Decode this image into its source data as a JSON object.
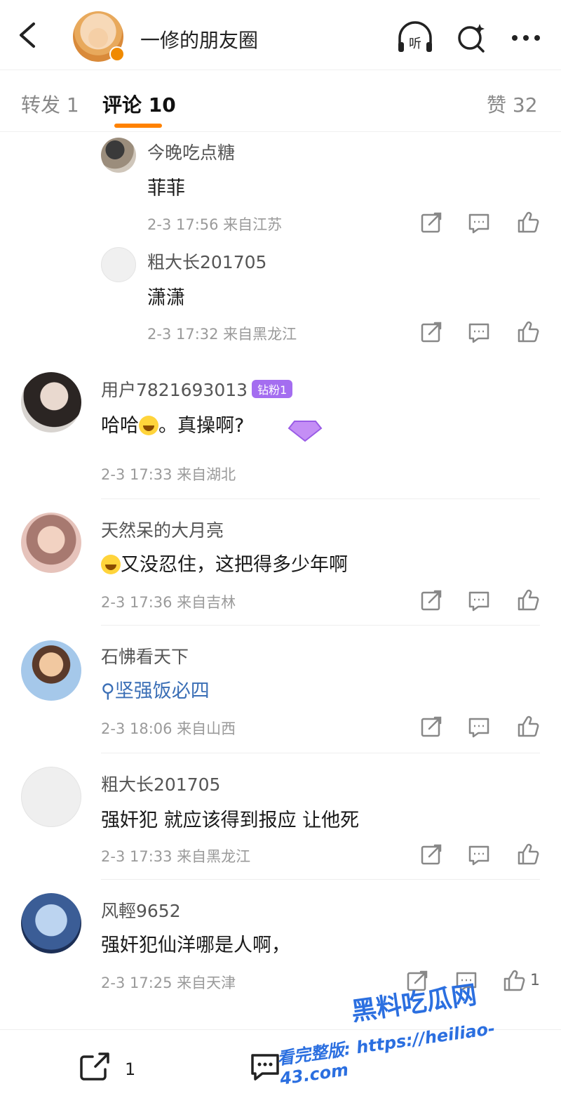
{
  "header": {
    "title": "一修的朋友圈",
    "icons": [
      "back-icon",
      "listen-icon",
      "search-ai-icon",
      "more-icon"
    ],
    "listen_label": "听"
  },
  "tabs": {
    "repost": "转发 1",
    "comments": "评论 10",
    "likes": "赞 32"
  },
  "replies": [
    {
      "name": "今晚吃点糖",
      "text": "菲菲",
      "meta": "2-3 17:56 来自江苏"
    },
    {
      "name": "粗大长201705",
      "text": "潇潇",
      "meta": "2-3 17:32 来自黑龙江"
    }
  ],
  "comments": [
    {
      "name": "用户7821693013",
      "badge": "钻粉1",
      "text": "哈哈",
      "text2": "。真操啊?",
      "meta": "2-3 17:33 来自湖北"
    },
    {
      "name": "天然呆的大月亮",
      "text": "又没忍住，这把得多少年啊",
      "meta": "2-3 17:36 来自吉林"
    },
    {
      "name": "石怫看天下",
      "text": "坚强饭必四",
      "meta": "2-3 18:06 来自山西"
    },
    {
      "name": "粗大长201705",
      "text": "强奸犯 就应该得到报应 让他死",
      "meta": "2-3 17:33 来自黑龙江"
    },
    {
      "name": "风輕9652",
      "text": "强奸犯仙洋哪是人啊，",
      "meta": "2-3 17:25 来自天津",
      "likes": "1"
    }
  ],
  "bottom": {
    "repost_count": "1"
  },
  "watermark": {
    "line1": "黑料吃瓜网",
    "line2": "看完整版: https://heiliao-43.com"
  },
  "colors": {
    "accent": "#ff8200",
    "link": "#3b6fb6",
    "badge": "#a46df0"
  }
}
